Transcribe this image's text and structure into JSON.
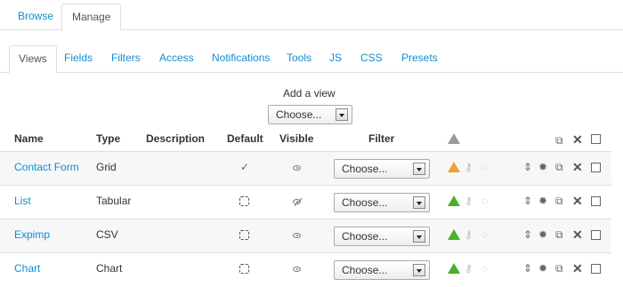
{
  "top_tabs": [
    {
      "label": "Browse",
      "active": false
    },
    {
      "label": "Manage",
      "active": true
    }
  ],
  "sub_tabs": [
    {
      "label": "Views",
      "active": true
    },
    {
      "label": "Fields"
    },
    {
      "label": "Filters"
    },
    {
      "label": "Access"
    },
    {
      "label": "Notifications"
    },
    {
      "label": "Tools"
    },
    {
      "label": "JS"
    },
    {
      "label": "CSS"
    },
    {
      "label": "Presets"
    }
  ],
  "add_view": {
    "label": "Add a view",
    "select_value": "Choose..."
  },
  "table": {
    "headers": {
      "name": "Name",
      "type": "Type",
      "description": "Description",
      "default": "Default",
      "visible": "Visible",
      "filter": "Filter"
    },
    "rows": [
      {
        "name": "Contact Form",
        "type": "Grid",
        "description": "",
        "default": true,
        "visible": true,
        "filter": "Choose...",
        "status_color": "#f0a030"
      },
      {
        "name": "List",
        "type": "Tabular",
        "description": "",
        "default": false,
        "visible": false,
        "filter": "Choose...",
        "status_color": "#4caf2a"
      },
      {
        "name": "Expimp",
        "type": "CSV",
        "description": "",
        "default": false,
        "visible": true,
        "filter": "Choose...",
        "status_color": "#4caf2a"
      },
      {
        "name": "Chart",
        "type": "Chart",
        "description": "",
        "default": false,
        "visible": true,
        "filter": "Choose...",
        "status_color": "#4caf2a"
      }
    ]
  },
  "icons": {
    "header_warning": "warning-icon",
    "copy": "copy-icon",
    "delete": "delete-icon",
    "sort": "sort-icon",
    "settings": "gear-icon",
    "permissions": "key-icon",
    "comment": "comment-icon"
  },
  "colors": {
    "link": "#0f8ecf",
    "row_alt_bg": "#f7f7f7",
    "border": "#dddddd"
  }
}
